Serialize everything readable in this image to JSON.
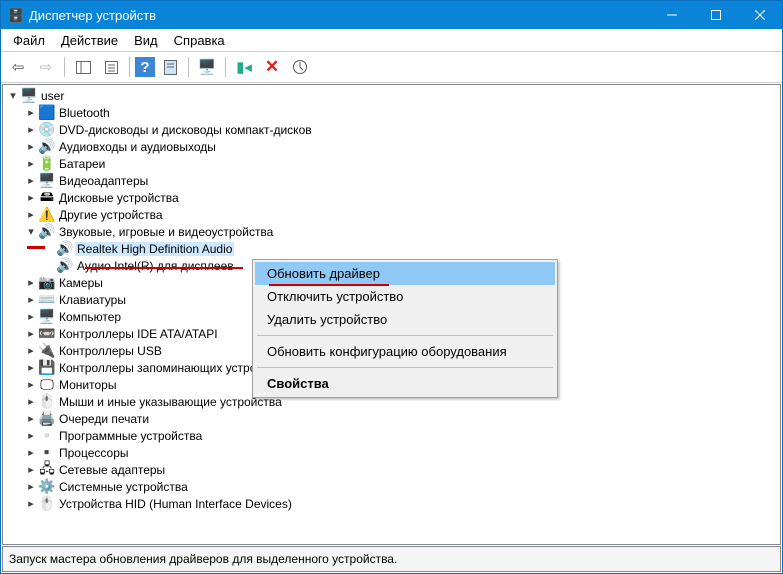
{
  "title": "Диспетчер устройств",
  "menu": [
    "Файл",
    "Действие",
    "Вид",
    "Справка"
  ],
  "computer": "user",
  "cats": [
    {
      "icon": "bt",
      "label": "Bluetooth",
      "exp": false,
      "open": false
    },
    {
      "icon": "disc",
      "label": "DVD-дисководы и дисководы компакт-дисков",
      "exp": false,
      "open": false
    },
    {
      "icon": "aud",
      "label": "Аудиовходы и аудиовыходы",
      "exp": false,
      "open": false
    },
    {
      "icon": "bat",
      "label": "Батареи",
      "exp": false,
      "open": false
    },
    {
      "icon": "disp",
      "label": "Видеоадаптеры",
      "exp": false,
      "open": false
    },
    {
      "icon": "hdd",
      "label": "Дисковые устройства",
      "exp": false,
      "open": false
    },
    {
      "icon": "warn",
      "label": "Другие устройства",
      "exp": false,
      "open": false
    },
    {
      "icon": "snd",
      "label": "Звуковые, игровые и видеоустройства",
      "exp": true,
      "open": true,
      "mark": true,
      "children": [
        {
          "icon": "snd",
          "label": "Realtek High Definition Audio",
          "mark": true,
          "sel": true
        },
        {
          "icon": "snd",
          "label": "Аудио Intel(R) для дисплеев"
        }
      ]
    },
    {
      "icon": "cam",
      "label": "Камеры",
      "exp": false,
      "open": false
    },
    {
      "icon": "kbd",
      "label": "Клавиатуры",
      "exp": false,
      "open": false
    },
    {
      "icon": "pc",
      "label": "Компьютер",
      "exp": false,
      "open": false
    },
    {
      "icon": "ide",
      "label": "Контроллеры IDE ATA/ATAPI",
      "exp": false,
      "open": false
    },
    {
      "icon": "usb",
      "label": "Контроллеры USB",
      "exp": false,
      "open": false
    },
    {
      "icon": "mem",
      "label": "Контроллеры запоминающих устройств",
      "exp": false,
      "open": false
    },
    {
      "icon": "mon",
      "label": "Мониторы",
      "exp": false,
      "open": false
    },
    {
      "icon": "mouse",
      "label": "Мыши и иные указывающие устройства",
      "exp": false,
      "open": false
    },
    {
      "icon": "prn",
      "label": "Очереди печати",
      "exp": false,
      "open": false
    },
    {
      "icon": "sw",
      "label": "Программные устройства",
      "exp": false,
      "open": false
    },
    {
      "icon": "cpu",
      "label": "Процессоры",
      "exp": false,
      "open": false
    },
    {
      "icon": "net",
      "label": "Сетевые адаптеры",
      "exp": false,
      "open": false
    },
    {
      "icon": "sys",
      "label": "Системные устройства",
      "exp": false,
      "open": false
    },
    {
      "icon": "hid",
      "label": "Устройства HID (Human Interface Devices)",
      "exp": false,
      "open": false
    }
  ],
  "ctx": {
    "update": "Обновить драйвер",
    "disable": "Отключить устройство",
    "remove": "Удалить устройство",
    "scan": "Обновить конфигурацию оборудования",
    "props": "Свойства"
  },
  "status": "Запуск мастера обновления драйверов для выделенного устройства."
}
